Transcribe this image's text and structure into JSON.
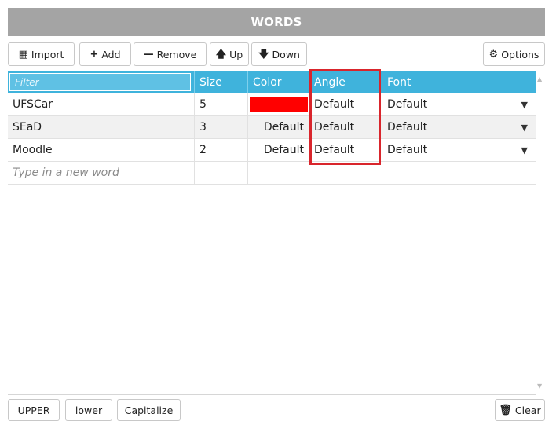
{
  "panel": {
    "title": "WORDS"
  },
  "toolbar": {
    "import_label": "Import",
    "add_label": "Add",
    "remove_label": "Remove",
    "up_label": "Up",
    "down_label": "Down",
    "options_label": "Options"
  },
  "grid": {
    "filter_placeholder": "Filter",
    "columns": {
      "size": "Size",
      "color": "Color",
      "angle": "Angle",
      "font": "Font"
    },
    "rows": [
      {
        "word": "UFSCar",
        "size": "5",
        "color": "",
        "color_value": "#ff0000",
        "angle": "Default",
        "font": "Default"
      },
      {
        "word": "SEaD",
        "size": "3",
        "color": "Default",
        "angle": "Default",
        "font": "Default"
      },
      {
        "word": "Moodle",
        "size": "2",
        "color": "Default",
        "angle": "Default",
        "font": "Default"
      }
    ],
    "new_word_placeholder": "Type in a new word",
    "dropdown_caret": "▼"
  },
  "bottom": {
    "upper_label": "UPPER",
    "lower_label": "lower",
    "capitalize_label": "Capitalize",
    "clear_label": "Clear"
  },
  "colors": {
    "header_bg": "#3fb3dc",
    "title_bg": "#a4a4a4",
    "highlight_border": "#d9252c",
    "swatch_red": "#ff0000"
  }
}
